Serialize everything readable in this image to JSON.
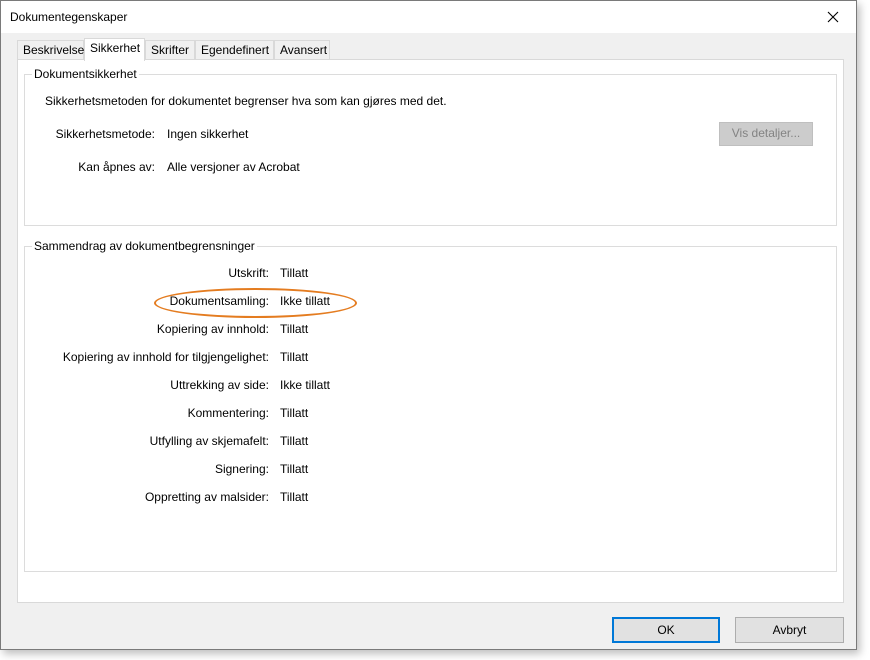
{
  "window": {
    "title": "Dokumentegenskaper"
  },
  "tabs": [
    {
      "label": "Beskrivelse"
    },
    {
      "label": "Sikkerhet"
    },
    {
      "label": "Skrifter"
    },
    {
      "label": "Egendefinert"
    },
    {
      "label": "Avansert"
    }
  ],
  "active_tab": "Sikkerhet",
  "security": {
    "group_title": "Dokumentsikkerhet",
    "description": "Sikkerhetsmetoden for dokumentet begrenser hva som kan gjøres med det.",
    "method_label": "Sikkerhetsmetode:",
    "method_value": "Ingen sikkerhet",
    "opens_label": "Kan åpnes av:",
    "opens_value": "Alle versjoner av Acrobat",
    "details_button": "Vis detaljer..."
  },
  "restrictions": {
    "group_title": "Sammendrag av dokumentbegrensninger",
    "rows": [
      {
        "label": "Utskrift:",
        "value": "Tillatt"
      },
      {
        "label": "Dokumentsamling:",
        "value": "Ikke tillatt"
      },
      {
        "label": "Kopiering av innhold:",
        "value": "Tillatt"
      },
      {
        "label": "Kopiering av innhold for tilgjengelighet:",
        "value": "Tillatt"
      },
      {
        "label": "Uttrekking av side:",
        "value": "Ikke tillatt"
      },
      {
        "label": "Kommentering:",
        "value": "Tillatt"
      },
      {
        "label": "Utfylling av skjemafelt:",
        "value": "Tillatt"
      },
      {
        "label": "Signering:",
        "value": "Tillatt"
      },
      {
        "label": "Oppretting av malsider:",
        "value": "Tillatt"
      }
    ]
  },
  "buttons": {
    "ok": "OK",
    "cancel": "Avbryt"
  },
  "colors": {
    "highlight": "#e47c20",
    "default_button_border": "#0078d7"
  }
}
